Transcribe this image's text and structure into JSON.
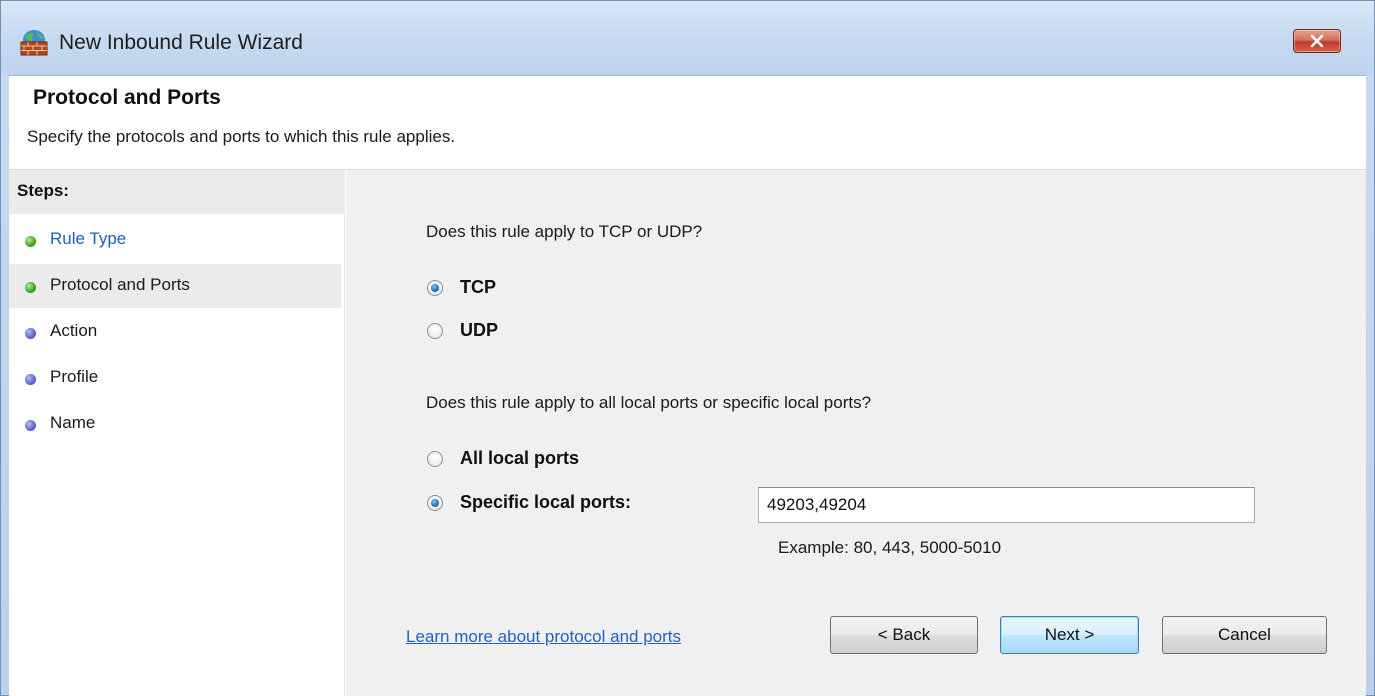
{
  "window": {
    "title": "New Inbound Rule Wizard",
    "icon": "firewall-icon",
    "close_icon": "close-icon"
  },
  "header": {
    "title": "Protocol and Ports",
    "subtitle": "Specify the protocols and ports to which this rule applies."
  },
  "steps": {
    "heading": "Steps:",
    "items": [
      {
        "label": "Rule Type",
        "state": "done",
        "link": true
      },
      {
        "label": "Protocol and Ports",
        "state": "done",
        "current": true
      },
      {
        "label": "Action",
        "state": "todo"
      },
      {
        "label": "Profile",
        "state": "todo"
      },
      {
        "label": "Name",
        "state": "todo"
      }
    ]
  },
  "protocol": {
    "question": "Does this rule apply to TCP or UDP?",
    "options": [
      {
        "label": "TCP",
        "selected": true
      },
      {
        "label": "UDP",
        "selected": false
      }
    ]
  },
  "ports": {
    "question": "Does this rule apply to all local ports or specific local ports?",
    "options": [
      {
        "label": "All local ports",
        "selected": false
      },
      {
        "label": "Specific local ports:",
        "selected": true
      }
    ],
    "value": "49203,49204",
    "example": "Example: 80, 443, 5000-5010"
  },
  "footer": {
    "learn_more": "Learn more about protocol and ports",
    "back_label": "< Back",
    "next_label": "Next >",
    "cancel_label": "Cancel"
  },
  "colors": {
    "link": "#1d63c4",
    "close_button": "#c0392b",
    "done_step": "#3fa31c",
    "todo_step": "#5b62d0"
  }
}
